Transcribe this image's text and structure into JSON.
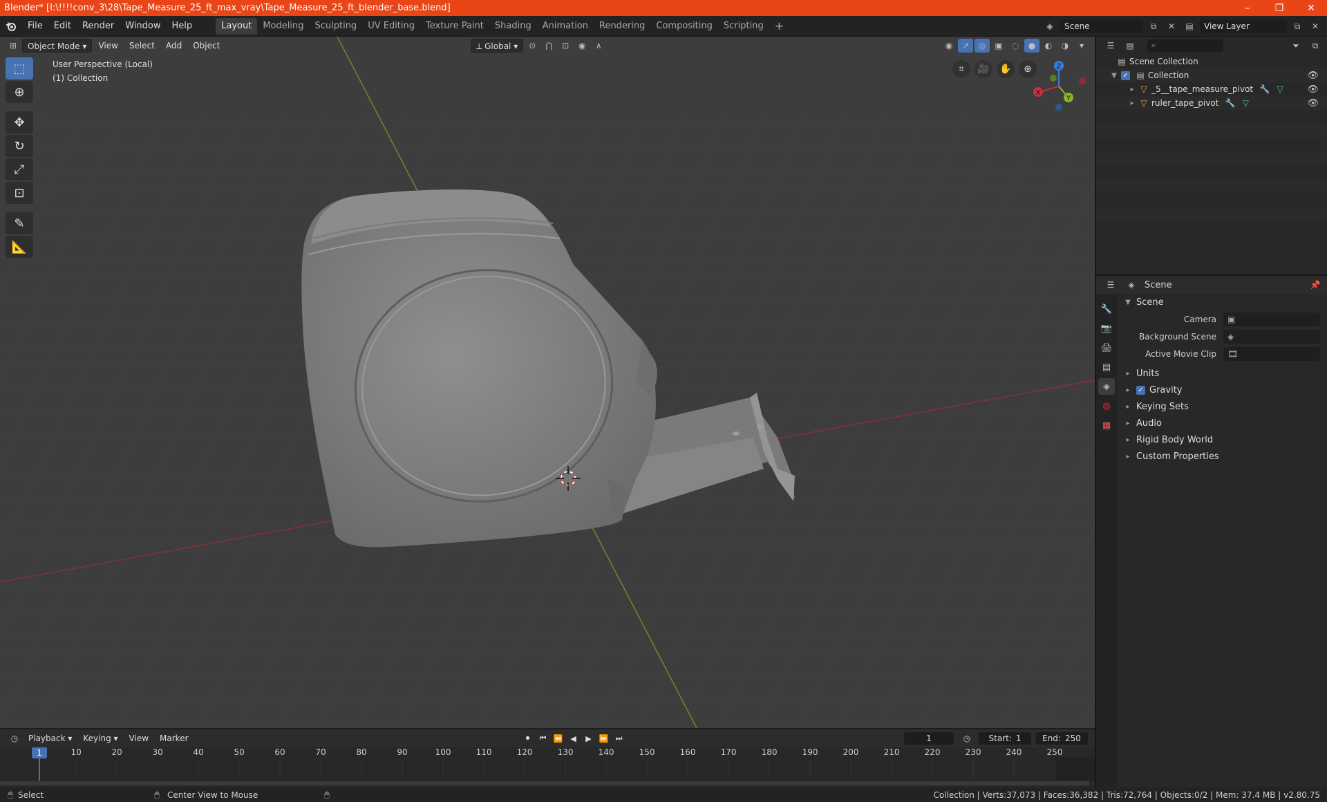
{
  "window": {
    "title": "Blender* [I:\\!!!!conv_3\\28\\Tape_Measure_25_ft_max_vray\\Tape_Measure_25_ft_blender_base.blend]",
    "minimize": "–",
    "maximize": "❐",
    "close": "✕"
  },
  "menu": {
    "items": [
      "File",
      "Edit",
      "Render",
      "Window",
      "Help"
    ]
  },
  "workspaces": {
    "tabs": [
      "Layout",
      "Modeling",
      "Sculpting",
      "UV Editing",
      "Texture Paint",
      "Shading",
      "Animation",
      "Rendering",
      "Compositing",
      "Scripting"
    ],
    "add": "+"
  },
  "topright": {
    "scene": "Scene",
    "view_layer": "View Layer"
  },
  "viewport": {
    "mode": "Object Mode",
    "menus": [
      "View",
      "Select",
      "Add",
      "Object"
    ],
    "transform": "Global",
    "perspective": "User Perspective (Local)",
    "collection": "(1) Collection",
    "gizmo": {
      "x": "X",
      "y": "Y",
      "z": "Z"
    }
  },
  "outliner": {
    "root": "Scene Collection",
    "collection": "Collection",
    "objects": [
      "_5__tape_measure_pivot",
      "ruler_tape_pivot"
    ]
  },
  "properties": {
    "header": "Scene",
    "section": "Scene",
    "rows": [
      {
        "label": "Camera"
      },
      {
        "label": "Background Scene"
      },
      {
        "label": "Active Movie Clip"
      }
    ],
    "panels": [
      "Units",
      "Gravity",
      "Keying Sets",
      "Audio",
      "Rigid Body World",
      "Custom Properties"
    ]
  },
  "timeline": {
    "menus": [
      "Playback",
      "Keying",
      "View",
      "Marker"
    ],
    "current_frame": "1",
    "start_label": "Start:",
    "start": "1",
    "end_label": "End:",
    "end": "250",
    "ticks": [
      "1",
      "10",
      "20",
      "30",
      "40",
      "50",
      "60",
      "70",
      "80",
      "90",
      "100",
      "110",
      "120",
      "130",
      "140",
      "150",
      "160",
      "170",
      "180",
      "190",
      "200",
      "210",
      "220",
      "230",
      "240",
      "250"
    ]
  },
  "status": {
    "select": "Select",
    "center": "Center View to Mouse",
    "stats": "Collection | Verts:37,073 | Faces:36,382 | Tris:72,764 | Objects:0/2 | Mem: 37.4 MB | v2.80.75"
  },
  "colors": {
    "title_bar": "#ea4517",
    "accent": "#4772b3",
    "viewport_bg": "#3d3d3d",
    "axis_x": "#c8303f",
    "axis_y": "#8ab42a",
    "axis_z": "#2f7fdf"
  }
}
